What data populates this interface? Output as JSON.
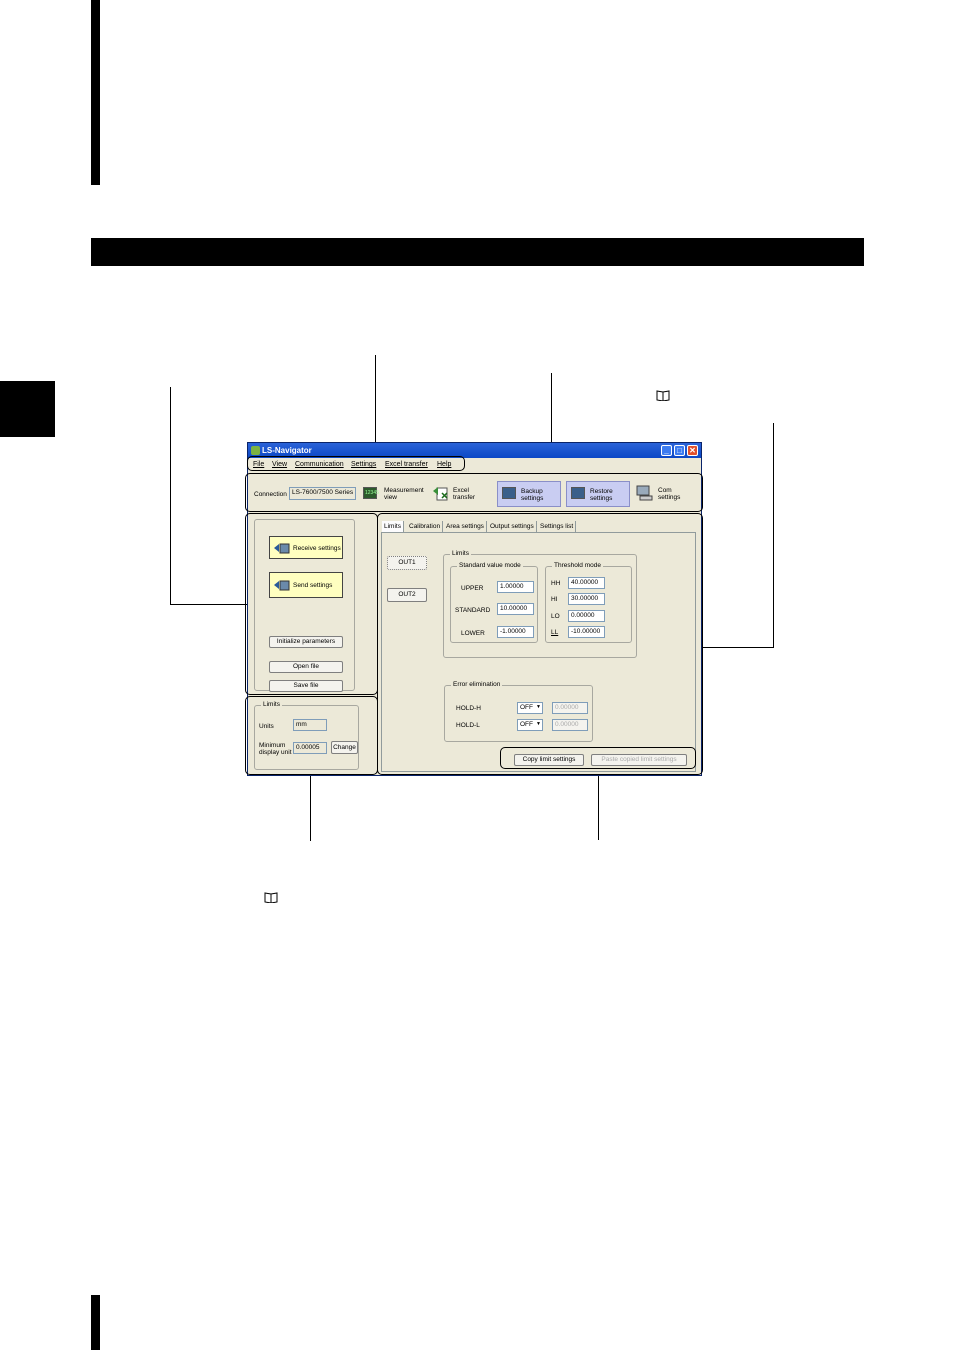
{
  "window": {
    "title": "LS-Navigator",
    "menu": [
      "File",
      "View",
      "Communication",
      "Settings",
      "Excel transfer",
      "Help"
    ]
  },
  "toolbar": {
    "connection_label": "Connection",
    "connection_value": "LS-7600/7500 Series",
    "measurement_view": "Measurement view",
    "measurement_icon_text": "12345",
    "excel_transfer": "Excel transfer",
    "backup_settings": "Backup settings",
    "restore_settings": "Restore settings",
    "com_settings": "Com settings"
  },
  "left_panel": {
    "receive_settings": "Receive settings",
    "send_settings": "Send settings",
    "initialize_parameters": "Initialize parameters",
    "open_file": "Open file",
    "save_file": "Save file"
  },
  "limits_panel": {
    "title": "Limits",
    "units_label": "Units",
    "units_value": "mm",
    "min_unit_label_1": "Minimum",
    "min_unit_label_2": "display unit",
    "min_unit_value": "0.00005",
    "change_button": "Change"
  },
  "tabs": [
    "Limits",
    "Calibration",
    "Area settings",
    "Output settings",
    "Settings list"
  ],
  "outputs": [
    "OUT1",
    "OUT2"
  ],
  "limits_group": {
    "title": "Limits",
    "standard_title": "Standard value mode",
    "upper_label": "UPPER",
    "upper_value": "1.00000",
    "standard_label": "STANDARD",
    "standard_value": "10.00000",
    "lower_label": "LOWER",
    "lower_value": "-1.00000",
    "threshold_title": "Threshold mode",
    "hh_label": "HH",
    "hh_value": "40.00000",
    "hi_label": "HI",
    "hi_value": "30.00000",
    "lo_label": "LO",
    "lo_value": "0.00000",
    "ll_label": "LL",
    "ll_value": "-10.00000"
  },
  "error_group": {
    "title": "Error elimination",
    "hold_h_label": "HOLD-H",
    "hold_h_select": "OFF",
    "hold_h_value": "0.00000",
    "hold_l_label": "HOLD-L",
    "hold_l_select": "OFF",
    "hold_l_value": "0.00000"
  },
  "bottom_buttons": {
    "copy": "Copy limit settings",
    "paste": "Paste copied limit settings"
  }
}
